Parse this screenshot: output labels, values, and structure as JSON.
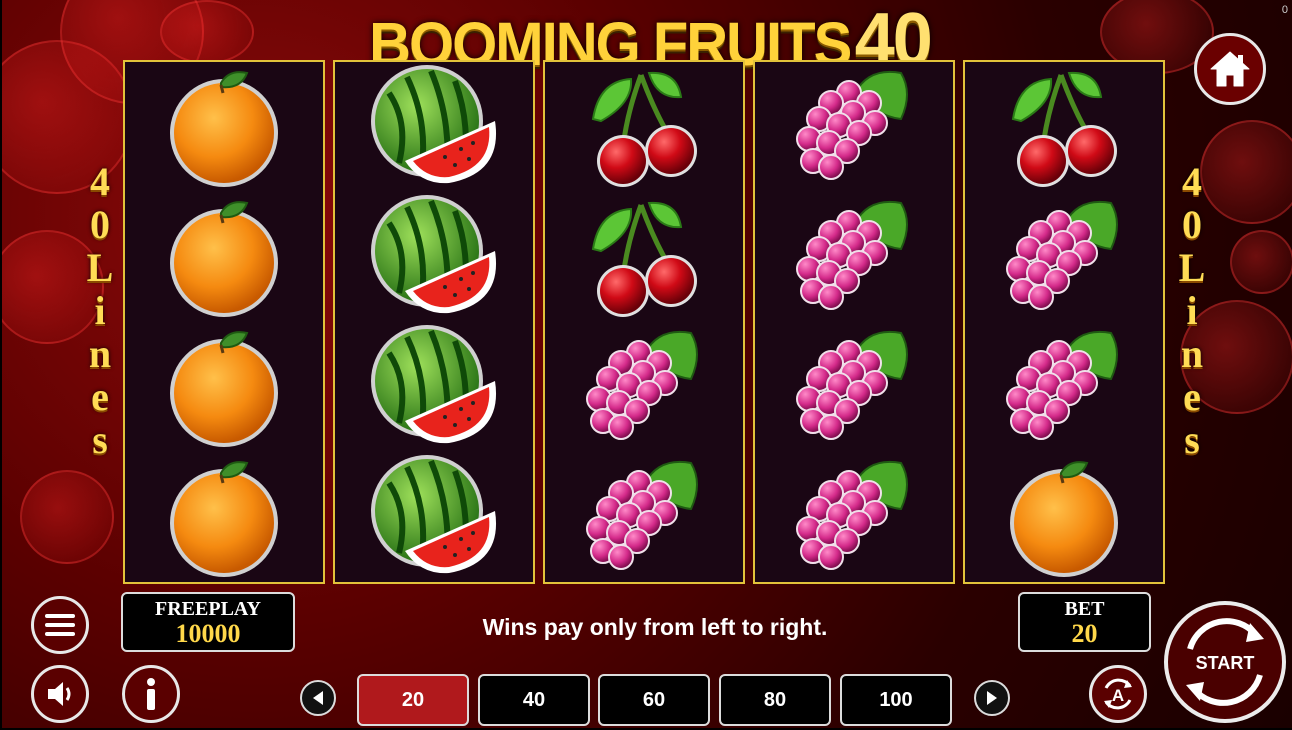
{
  "corner_text": "0",
  "logo": {
    "title": "BOOMING FRUITS",
    "number": "40"
  },
  "side_label": [
    "4",
    "0",
    "L",
    "i",
    "n",
    "e",
    "s"
  ],
  "reels": [
    [
      "orange",
      "orange",
      "orange",
      "orange"
    ],
    [
      "watermelon",
      "watermelon",
      "watermelon",
      "watermelon"
    ],
    [
      "cherry",
      "cherry",
      "grapes",
      "grapes"
    ],
    [
      "grapes",
      "grapes",
      "grapes",
      "grapes"
    ],
    [
      "cherry",
      "grapes",
      "grapes",
      "orange"
    ]
  ],
  "freeplay": {
    "label": "FREEPLAY",
    "value": "10000"
  },
  "bet": {
    "label": "BET",
    "value": "20"
  },
  "message": "Wins pay only from left to right.",
  "lines": {
    "options": [
      "20",
      "40",
      "60",
      "80",
      "100"
    ],
    "selected": "20"
  },
  "start_label": "START",
  "icons": {
    "home": "home-icon",
    "menu": "menu-icon",
    "sound": "sound-icon",
    "info": "info-icon",
    "prev": "arrow-left-icon",
    "next": "arrow-right-icon",
    "autoplay": "autoplay-icon",
    "start": "spin-arrows-icon"
  },
  "colors": {
    "reel_border": "#e2c23a",
    "active_line": "#b0191c",
    "gold_text": "#ffd84a"
  }
}
